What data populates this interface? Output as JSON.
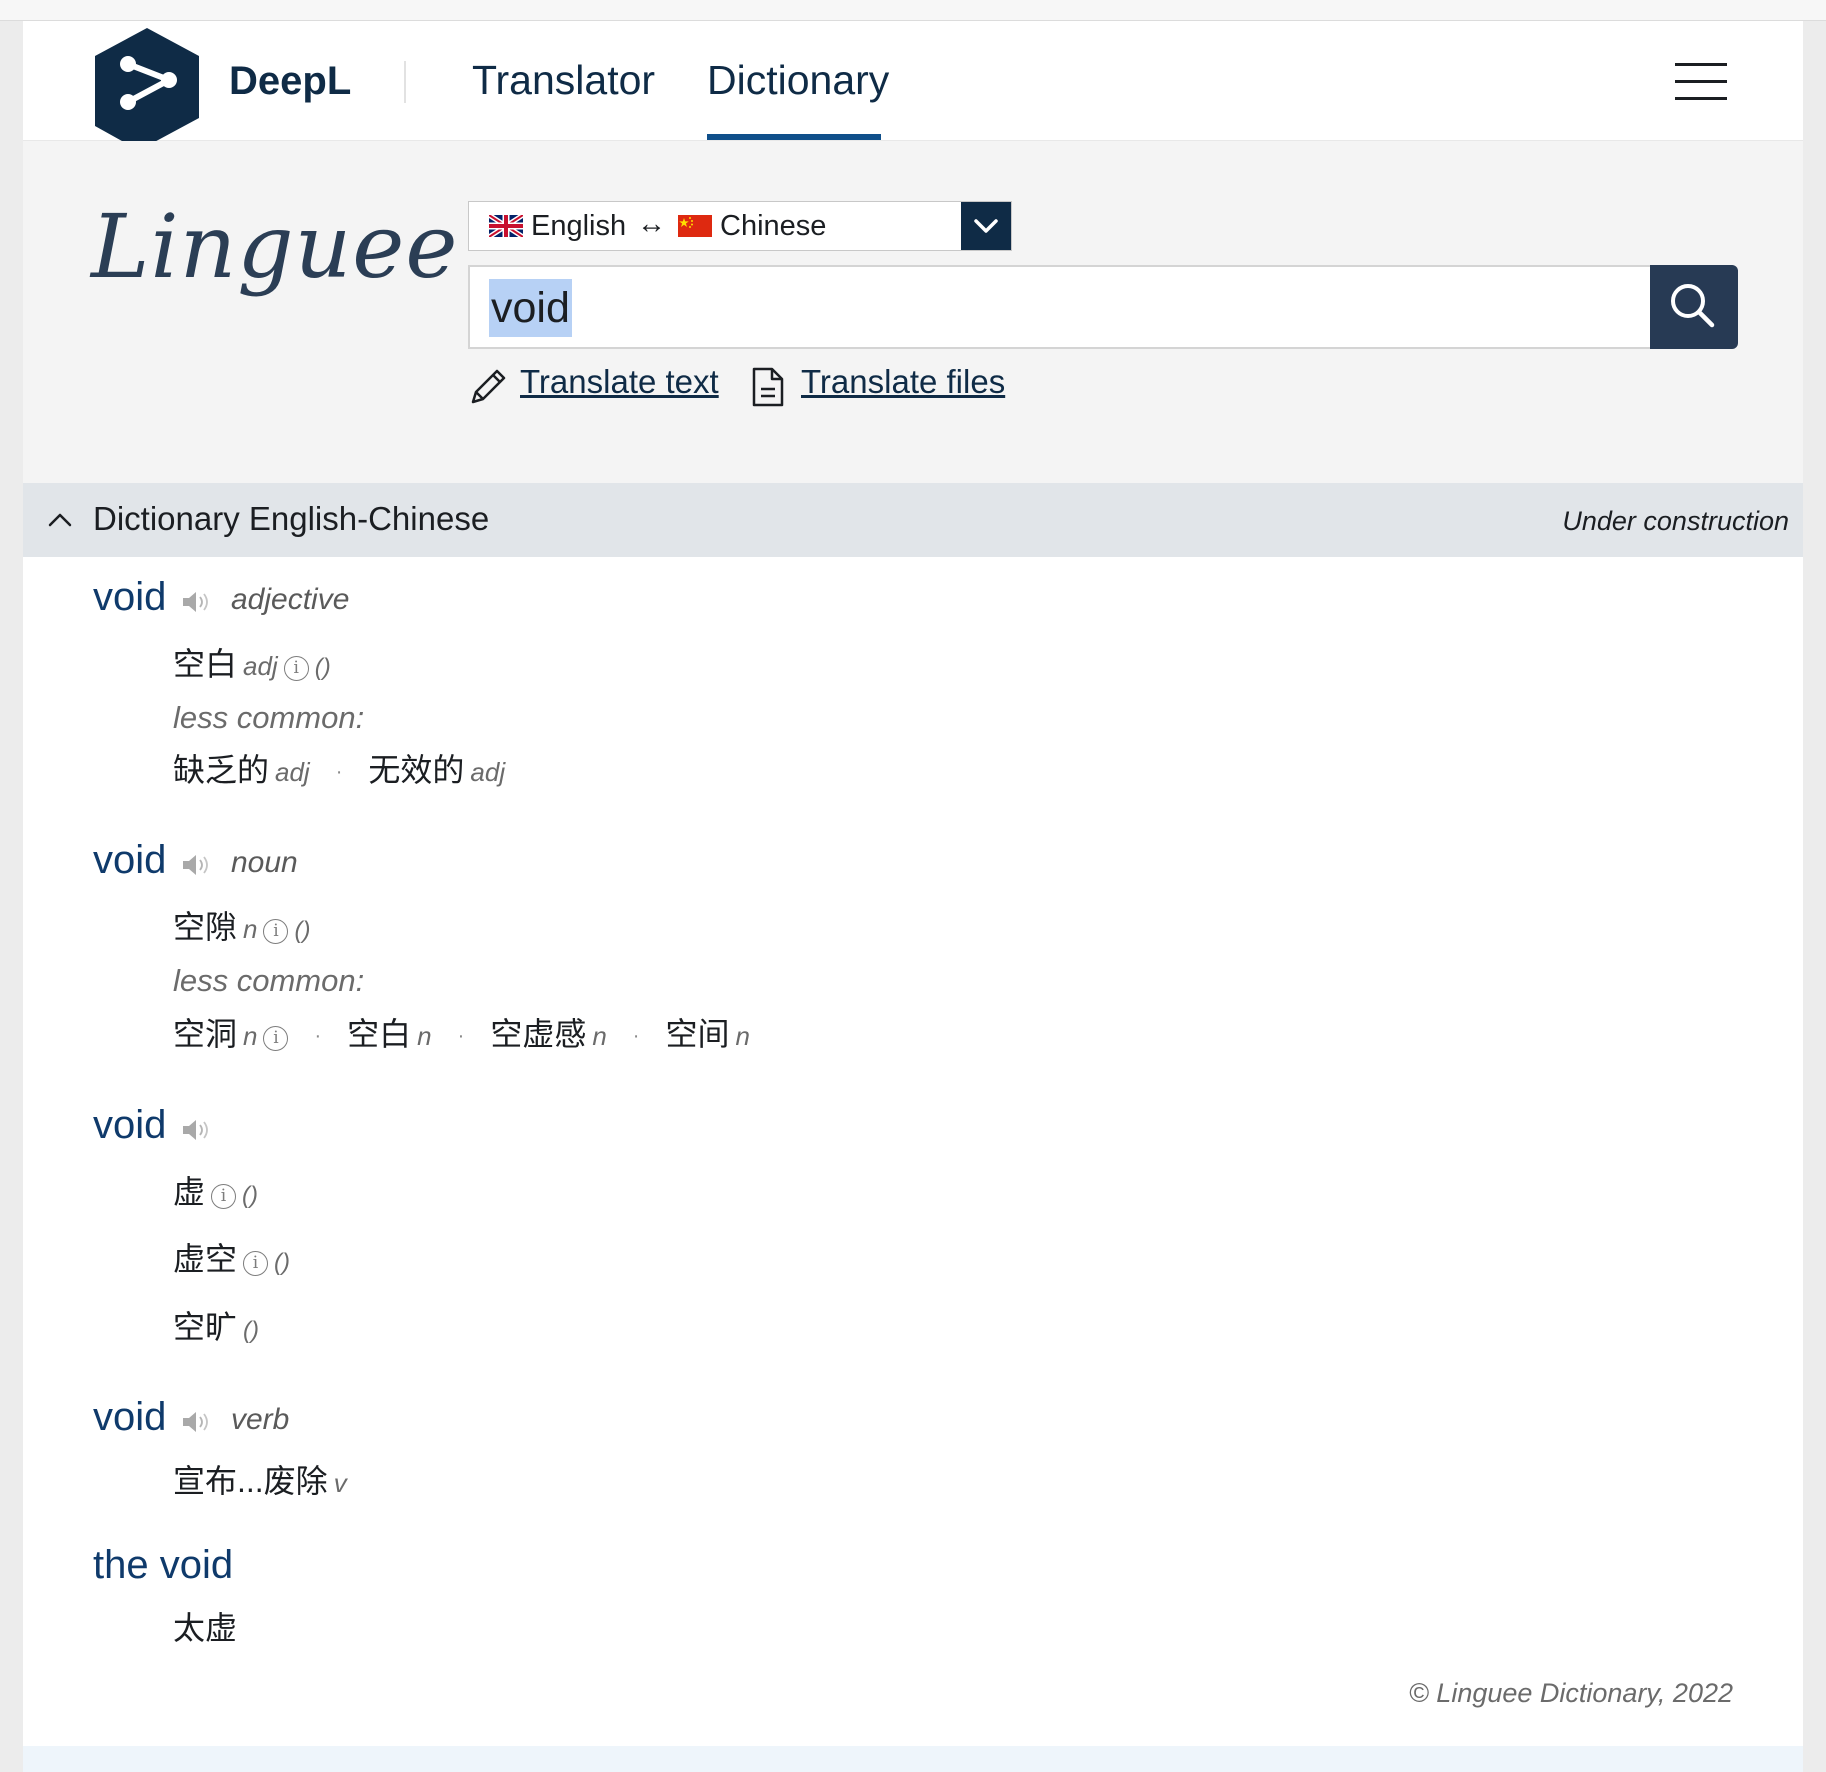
{
  "header": {
    "brand": "DeepL",
    "nav": {
      "translator": "Translator",
      "dictionary": "Dictionary"
    },
    "active_tab": "Dictionary"
  },
  "search": {
    "logo_text": "Linguee",
    "language_pair": {
      "source": "English",
      "arrow": "↔",
      "target": "Chinese"
    },
    "query": "void",
    "translate_text_label": "Translate text",
    "translate_files_label": "Translate files"
  },
  "dictionary_bar": {
    "title": "Dictionary English-Chinese",
    "status": "Under construction"
  },
  "entries": [
    {
      "headword": "void",
      "pos": "adjective",
      "translations": [
        {
          "text": "空白",
          "tag": "adj",
          "info": "i",
          "paren": "()"
        }
      ],
      "less_common_label": "less common:",
      "less_common": [
        {
          "text": "缺乏的",
          "tag": "adj"
        },
        {
          "text": "无效的",
          "tag": "adj"
        }
      ]
    },
    {
      "headword": "void",
      "pos": "noun",
      "translations": [
        {
          "text": "空隙",
          "tag": "n",
          "info": "i",
          "paren": "()"
        }
      ],
      "less_common_label": "less common:",
      "less_common": [
        {
          "text": "空洞",
          "tag": "n",
          "info": "i"
        },
        {
          "text": "空白",
          "tag": "n"
        },
        {
          "text": "空虚感",
          "tag": "n"
        },
        {
          "text": "空间",
          "tag": "n"
        }
      ]
    },
    {
      "headword": "void",
      "pos": "",
      "translations": [
        {
          "text": "虚",
          "info": "i",
          "paren": "()"
        },
        {
          "text": "虚空",
          "info": "i",
          "paren": "()"
        },
        {
          "text": "空旷",
          "paren": "()"
        }
      ]
    },
    {
      "headword": "void",
      "pos": "verb",
      "translations": [
        {
          "text": "宣布...废除",
          "tag": "v"
        }
      ]
    },
    {
      "headword": "the void",
      "translations": [
        {
          "text": "太虚"
        }
      ]
    }
  ],
  "separator": "·",
  "footer": {
    "copyright": "© Linguee Dictionary, 2022"
  },
  "colors": {
    "brand_navy": "#0f2b46",
    "headword_blue": "#0f3a6b",
    "selection": "#b7d1f5",
    "dict_bar": "#e1e5e9"
  },
  "icons": [
    "deepl-logo-icon",
    "hamburger-menu-icon",
    "uk-flag-icon",
    "china-flag-icon",
    "chevron-down-icon",
    "search-icon",
    "pencil-icon",
    "document-icon",
    "chevron-up-icon",
    "speaker-icon",
    "info-icon"
  ]
}
